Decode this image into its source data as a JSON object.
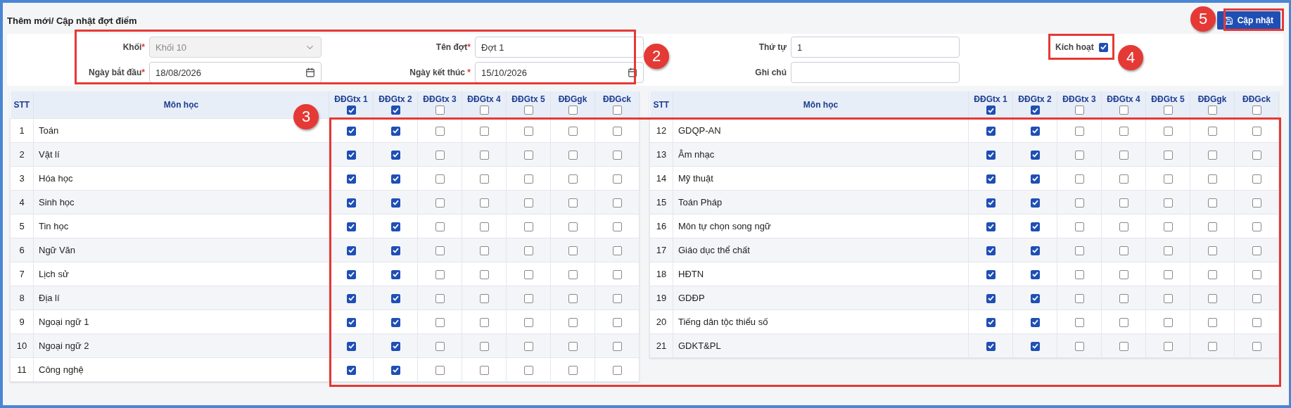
{
  "page_title": "Thêm mới/ Cập nhật đợt điểm",
  "update_button": {
    "label": "Cập nhật"
  },
  "form": {
    "fields": [
      {
        "kind": "select",
        "label": "Khối",
        "mark": "*",
        "value": "Khối 10",
        "disabled": true
      },
      {
        "kind": "text",
        "label": "Tên đợt",
        "mark": "*",
        "value": "Đợt 1"
      },
      {
        "kind": "text",
        "label": "Thứ tự",
        "value": "1"
      },
      {
        "kind": "checkbox",
        "label": "Kích hoạt",
        "checked": true
      },
      {
        "kind": "date",
        "label": "Ngày bắt đầu",
        "mark": "*",
        "value": "18/08/2026"
      },
      {
        "kind": "date",
        "label": "Ngày kết thúc",
        "mark": " *",
        "value": "15/10/2026"
      },
      {
        "kind": "text",
        "label": "Ghi chú"
      }
    ]
  },
  "tables": [
    {
      "stt_header": "STT",
      "subject_header": "Môn học",
      "columns": [
        {
          "label": "ĐĐGtx 1",
          "checked": true
        },
        {
          "label": "ĐĐGtx 2",
          "checked": true
        },
        {
          "label": "ĐĐGtx 3",
          "checked": false
        },
        {
          "label": "ĐĐGtx 4",
          "checked": false
        },
        {
          "label": "ĐĐGtx 5",
          "checked": false
        },
        {
          "label": "ĐĐGgk",
          "checked": false
        },
        {
          "label": "ĐĐGck",
          "checked": false
        }
      ],
      "rows": [
        {
          "stt": "1",
          "subject": "Toán",
          "checks": [
            true,
            true,
            false,
            false,
            false,
            false,
            false
          ]
        },
        {
          "stt": "2",
          "subject": "Vật lí",
          "checks": [
            true,
            true,
            false,
            false,
            false,
            false,
            false
          ]
        },
        {
          "stt": "3",
          "subject": "Hóa học",
          "checks": [
            true,
            true,
            false,
            false,
            false,
            false,
            false
          ]
        },
        {
          "stt": "4",
          "subject": "Sinh học",
          "checks": [
            true,
            true,
            false,
            false,
            false,
            false,
            false
          ]
        },
        {
          "stt": "5",
          "subject": "Tin học",
          "checks": [
            true,
            true,
            false,
            false,
            false,
            false,
            false
          ]
        },
        {
          "stt": "6",
          "subject": "Ngữ Văn",
          "checks": [
            true,
            true,
            false,
            false,
            false,
            false,
            false
          ]
        },
        {
          "stt": "7",
          "subject": "Lịch sử",
          "checks": [
            true,
            true,
            false,
            false,
            false,
            false,
            false
          ]
        },
        {
          "stt": "8",
          "subject": "Địa lí",
          "checks": [
            true,
            true,
            false,
            false,
            false,
            false,
            false
          ]
        },
        {
          "stt": "9",
          "subject": "Ngoại ngữ 1",
          "checks": [
            true,
            true,
            false,
            false,
            false,
            false,
            false
          ]
        },
        {
          "stt": "10",
          "subject": "Ngoại ngữ 2",
          "checks": [
            true,
            true,
            false,
            false,
            false,
            false,
            false
          ]
        },
        {
          "stt": "11",
          "subject": "Công nghệ",
          "checks": [
            true,
            true,
            false,
            false,
            false,
            false,
            false
          ]
        }
      ]
    },
    {
      "stt_header": "STT",
      "subject_header": "Môn học",
      "columns": [
        {
          "label": "ĐĐGtx 1",
          "checked": true
        },
        {
          "label": "ĐĐGtx 2",
          "checked": true
        },
        {
          "label": "ĐĐGtx 3",
          "checked": false
        },
        {
          "label": "ĐĐGtx 4",
          "checked": false
        },
        {
          "label": "ĐĐGtx 5",
          "checked": false
        },
        {
          "label": "ĐĐGgk",
          "checked": false
        },
        {
          "label": "ĐĐGck",
          "checked": false
        }
      ],
      "rows": [
        {
          "stt": "12",
          "subject": "GDQP-AN",
          "checks": [
            true,
            true,
            false,
            false,
            false,
            false,
            false
          ]
        },
        {
          "stt": "13",
          "subject": "Âm nhạc",
          "checks": [
            true,
            true,
            false,
            false,
            false,
            false,
            false
          ]
        },
        {
          "stt": "14",
          "subject": "Mỹ thuật",
          "checks": [
            true,
            true,
            false,
            false,
            false,
            false,
            false
          ]
        },
        {
          "stt": "15",
          "subject": "Toán Pháp",
          "checks": [
            true,
            true,
            false,
            false,
            false,
            false,
            false
          ]
        },
        {
          "stt": "16",
          "subject": "Môn tự chọn song ngữ",
          "checks": [
            true,
            true,
            false,
            false,
            false,
            false,
            false
          ]
        },
        {
          "stt": "17",
          "subject": "Giáo dục thể chất",
          "checks": [
            true,
            true,
            false,
            false,
            false,
            false,
            false
          ]
        },
        {
          "stt": "18",
          "subject": "HĐTN",
          "checks": [
            true,
            true,
            false,
            false,
            false,
            false,
            false
          ]
        },
        {
          "stt": "19",
          "subject": "GDĐP",
          "checks": [
            true,
            true,
            false,
            false,
            false,
            false,
            false
          ]
        },
        {
          "stt": "20",
          "subject": "Tiếng dân tộc thiểu số",
          "checks": [
            true,
            true,
            false,
            false,
            false,
            false,
            false
          ]
        },
        {
          "stt": "21",
          "subject": "GDKT&PL",
          "checks": [
            true,
            true,
            false,
            false,
            false,
            false,
            false
          ]
        }
      ]
    }
  ],
  "callouts": [
    {
      "number": "2"
    },
    {
      "number": "3"
    },
    {
      "number": "4"
    },
    {
      "number": "5"
    }
  ]
}
